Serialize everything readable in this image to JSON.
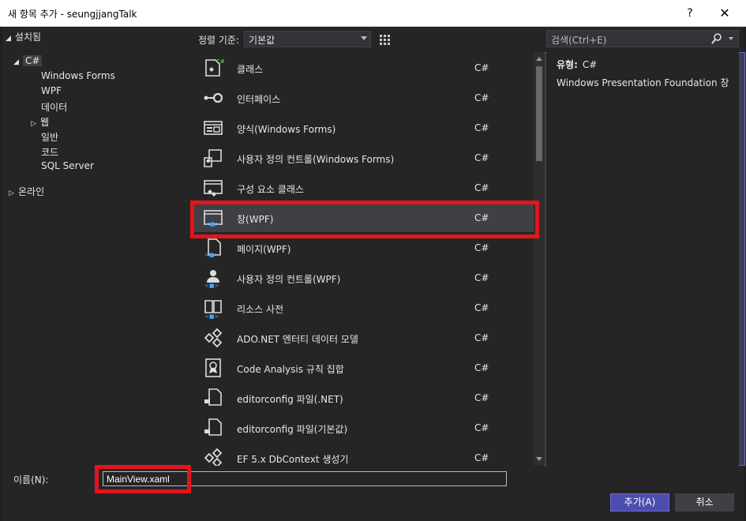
{
  "window": {
    "title": "새 항목 추가 - seungjjangTalk",
    "help": "?",
    "close": "✕"
  },
  "left": {
    "header": "설치됨",
    "tree": [
      {
        "label": "C#",
        "expanded": true
      },
      {
        "label": "Windows Forms"
      },
      {
        "label": "WPF"
      },
      {
        "label": "데이터"
      },
      {
        "label": "웹",
        "collapsed": true
      },
      {
        "label": "일반"
      },
      {
        "label": "코드"
      },
      {
        "label": "SQL Server"
      },
      {
        "label": "온라인",
        "collapsed": true
      }
    ]
  },
  "toolbar": {
    "sort_label": "정렬 기준:",
    "sort_value": "기본값",
    "search_placeholder": "검색(Ctrl+E)"
  },
  "templates": [
    {
      "name": "클래스",
      "lang": "C#",
      "icon": "class-icon"
    },
    {
      "name": "인터페이스",
      "lang": "C#",
      "icon": "interface-icon"
    },
    {
      "name": "양식(Windows Forms)",
      "lang": "C#",
      "icon": "form-icon"
    },
    {
      "name": "사용자 정의 컨트롤(Windows Forms)",
      "lang": "C#",
      "icon": "user-control-icon"
    },
    {
      "name": "구성 요소 클래스",
      "lang": "C#",
      "icon": "component-class-icon"
    },
    {
      "name": "창(WPF)",
      "lang": "C#",
      "icon": "wpf-window-icon",
      "selected": true
    },
    {
      "name": "페이지(WPF)",
      "lang": "C#",
      "icon": "wpf-page-icon"
    },
    {
      "name": "사용자 정의 컨트롤(WPF)",
      "lang": "C#",
      "icon": "wpf-user-control-icon"
    },
    {
      "name": "리소스 사전",
      "lang": "C#",
      "icon": "resource-dictionary-icon"
    },
    {
      "name": "ADO.NET 엔터티 데이터 모델",
      "lang": "C#",
      "icon": "ado-model-icon"
    },
    {
      "name": "Code Analysis 규칙 집합",
      "lang": "C#",
      "icon": "ruleset-icon"
    },
    {
      "name": "editorconfig 파일(.NET)",
      "lang": "C#",
      "icon": "editorconfig-icon"
    },
    {
      "name": "editorconfig 파일(기본값)",
      "lang": "C#",
      "icon": "editorconfig-icon"
    },
    {
      "name": "EF 5.x DbContext 생성기",
      "lang": "C#",
      "icon": "ef-generator-icon"
    }
  ],
  "info": {
    "type_label": "유형:",
    "type_value": "C#",
    "description": "Windows Presentation Foundation 창"
  },
  "bottom": {
    "name_label": "이름(N):",
    "name_value": "MainView.xaml",
    "add_button": "추가(A)",
    "cancel_button": "취소"
  },
  "colors": {
    "accent": "#4d4daf",
    "highlight": "#e3151a",
    "selected_row": "#3f3f46",
    "background": "#252526"
  }
}
